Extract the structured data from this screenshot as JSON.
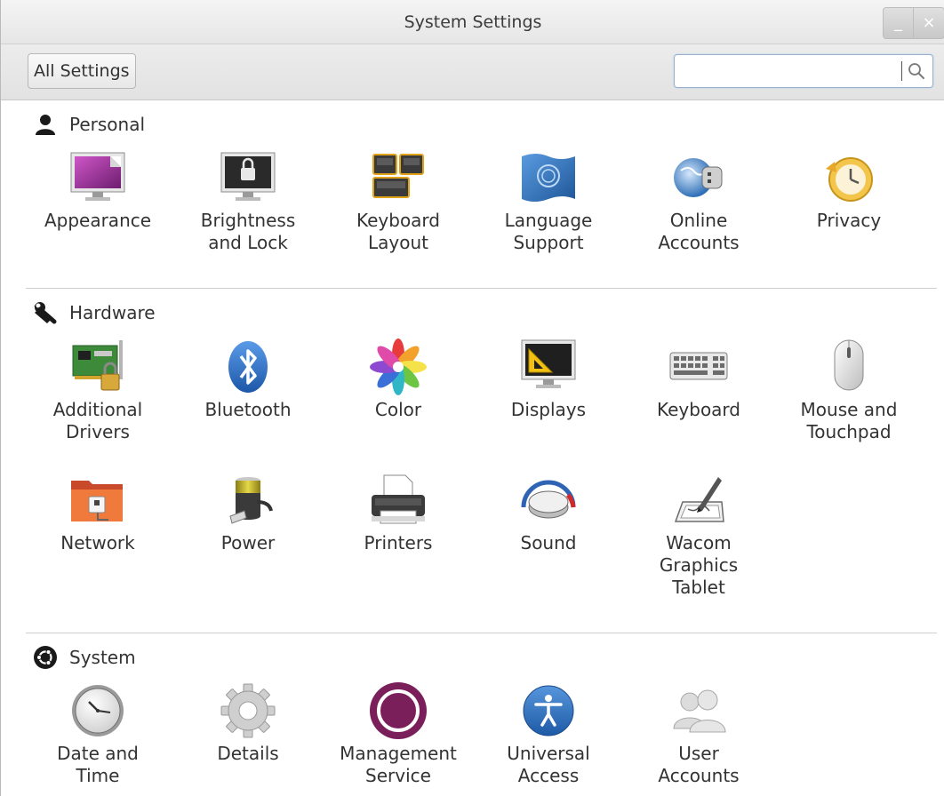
{
  "window": {
    "title": "System Settings",
    "minimize_glyph": "_",
    "close_glyph": "×"
  },
  "toolbar": {
    "all_settings_label": "All Settings",
    "search_value": "",
    "search_placeholder": ""
  },
  "sections": {
    "personal": {
      "label": "Personal",
      "icon": "person-icon",
      "items": [
        {
          "label": "Appearance",
          "icon": "appearance-icon"
        },
        {
          "label": "Brightness\nand Lock",
          "icon": "brightness-lock-icon"
        },
        {
          "label": "Keyboard\nLayout",
          "icon": "keyboard-layout-icon"
        },
        {
          "label": "Language\nSupport",
          "icon": "language-flag-icon"
        },
        {
          "label": "Online\nAccounts",
          "icon": "online-accounts-icon"
        },
        {
          "label": "Privacy",
          "icon": "privacy-clock-icon"
        }
      ]
    },
    "hardware": {
      "label": "Hardware",
      "icon": "wrench-icon",
      "items": [
        {
          "label": "Additional\nDrivers",
          "icon": "drivers-board-icon"
        },
        {
          "label": "Bluetooth",
          "icon": "bluetooth-icon"
        },
        {
          "label": "Color",
          "icon": "color-flower-icon"
        },
        {
          "label": "Displays",
          "icon": "display-monitor-icon"
        },
        {
          "label": "Keyboard",
          "icon": "keyboard-icon"
        },
        {
          "label": "Mouse and\nTouchpad",
          "icon": "mouse-icon"
        },
        {
          "label": "Network",
          "icon": "network-folder-icon"
        },
        {
          "label": "Power",
          "icon": "battery-plug-icon"
        },
        {
          "label": "Printers",
          "icon": "printer-icon"
        },
        {
          "label": "Sound",
          "icon": "sound-knob-icon"
        },
        {
          "label": "Wacom\nGraphics\nTablet",
          "icon": "graphics-tablet-icon"
        }
      ]
    },
    "system": {
      "label": "System",
      "icon": "ubuntu-logo-icon",
      "items": [
        {
          "label": "Date and\nTime",
          "icon": "clock-icon"
        },
        {
          "label": "Details",
          "icon": "gear-icon"
        },
        {
          "label": "Management\nService",
          "icon": "management-ring-icon"
        },
        {
          "label": "Universal\nAccess",
          "icon": "accessibility-icon"
        },
        {
          "label": "User\nAccounts",
          "icon": "users-icon"
        }
      ]
    }
  },
  "colors": {
    "accent_purple": "#7a1f5a",
    "bluetooth_blue": "#3a78c9",
    "access_blue": "#2f6fb8"
  }
}
